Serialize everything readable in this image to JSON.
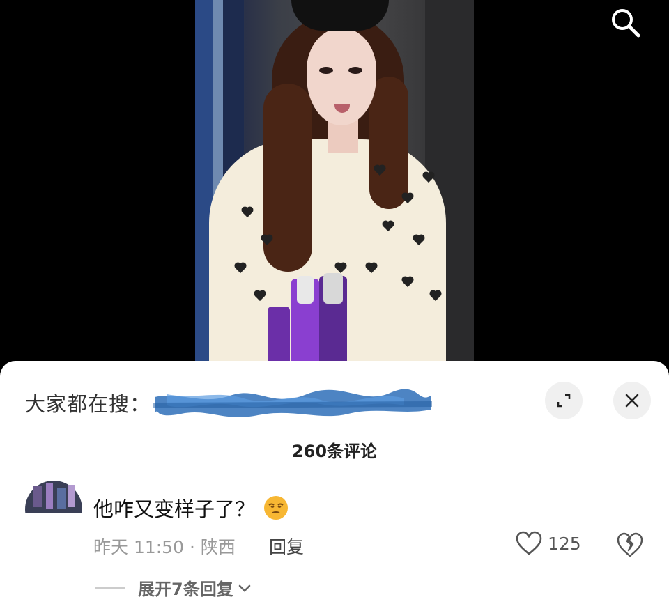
{
  "header": {
    "search_icon": "search-icon"
  },
  "sheet": {
    "trending_label": "大家都在搜：",
    "expand_icon": "expand-icon",
    "close_icon": "close-icon",
    "comment_count_label": "260条评论"
  },
  "comment": {
    "text": "他咋又变样子了？",
    "emoji": "smirk-emoji",
    "meta": "昨天 11:50 · 陕西",
    "reply_label": "回复",
    "like_count": "125",
    "expand_label": "展开7条回复"
  },
  "colors": {
    "sheet_bg": "#ffffff",
    "muted_text": "#999999",
    "heart_outline": "#555555"
  }
}
